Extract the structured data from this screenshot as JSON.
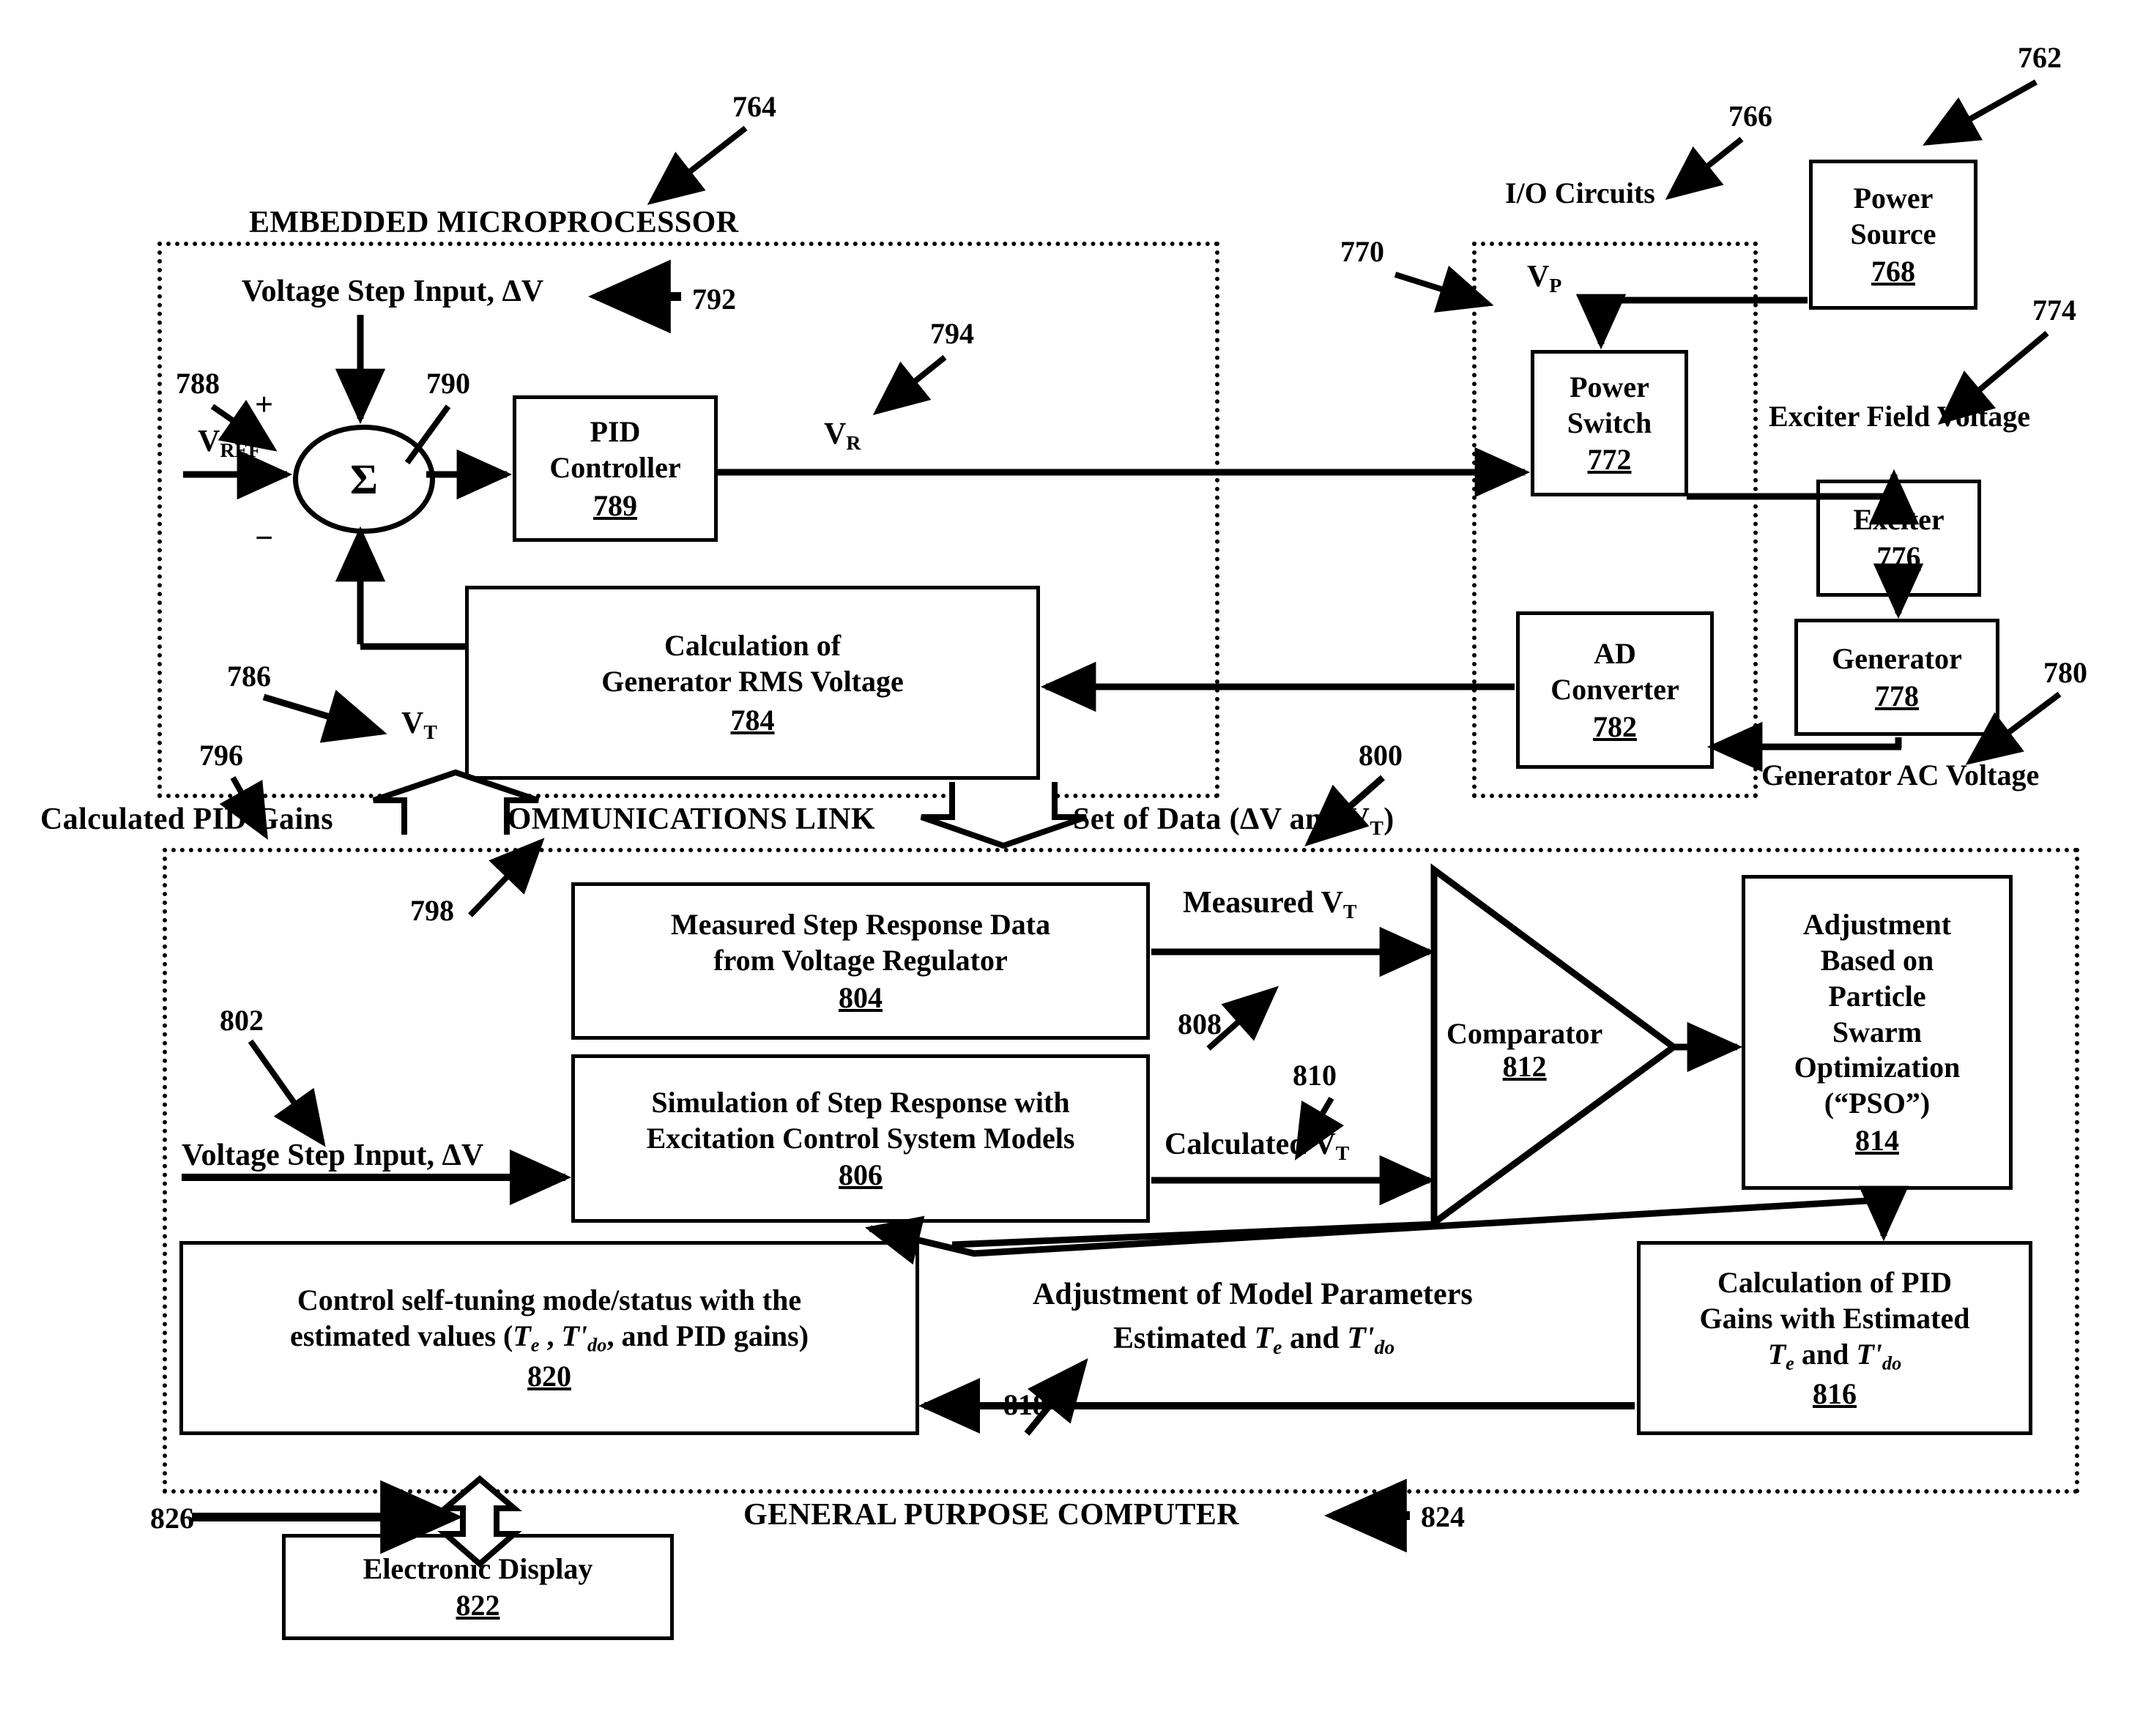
{
  "figure": {
    "enclosures": {
      "embedded_microprocessor": "EMBEDDED MICROPROCESSOR",
      "io_circuits": "I/O Circuits",
      "communications_link": "COMMUNICATIONS LINK",
      "general_purpose_computer": "GENERAL PURPOSE COMPUTER"
    },
    "ref_numbers": {
      "n762": "762",
      "n764": "764",
      "n766": "766",
      "n768": "768",
      "n770": "770",
      "n772": "772",
      "n774": "774",
      "n776": "776",
      "n778": "778",
      "n780": "780",
      "n782": "782",
      "n784": "784",
      "n786": "786",
      "n788": "788",
      "n789": "789",
      "n790": "790",
      "n792": "792",
      "n794": "794",
      "n796": "796",
      "n798": "798",
      "n800": "800",
      "n802": "802",
      "n804": "804",
      "n806": "806",
      "n808": "808",
      "n810": "810",
      "n812": "812",
      "n814": "814",
      "n816": "816",
      "n818": "818",
      "n820": "820",
      "n822": "822",
      "n824": "824",
      "n826": "826"
    },
    "blocks": {
      "pid_controller": {
        "line1": "PID",
        "line2": "Controller",
        "num": "789"
      },
      "rms_calculation": {
        "line1": "Calculation of",
        "line2": "Generator RMS Voltage",
        "num": "784"
      },
      "power_source": {
        "line1": "Power",
        "line2": "Source",
        "num": "768"
      },
      "power_switch": {
        "line1": "Power",
        "line2": "Switch",
        "num": "772"
      },
      "exciter": {
        "line1": "Exciter",
        "num": "776"
      },
      "generator": {
        "line1": "Generator",
        "num": "778"
      },
      "ad_converter": {
        "line1": "AD",
        "line2": "Converter",
        "num": "782"
      },
      "measured_step": {
        "line1": "Measured Step Response Data",
        "line2": "from Voltage Regulator",
        "num": "804"
      },
      "simulation": {
        "line1": "Simulation of Step Response with",
        "line2": "Excitation Control System Models",
        "num": "806"
      },
      "comparator": {
        "line1": "Comparator",
        "num": "812"
      },
      "pso": {
        "lines": [
          "Adjustment",
          "Based on",
          "Particle",
          "Swarm",
          "Optimization",
          "(“PSO”)"
        ],
        "num": "814"
      },
      "pid_gain_calc": {
        "line1": "Calculation of PID",
        "line2": "Gains with Estimated",
        "num": "816"
      },
      "self_tuning": {
        "line1": "Control self-tuning mode/status with the",
        "num": "820"
      },
      "electronic_display": {
        "line1": "Electronic Display",
        "num": "822"
      }
    },
    "signal_labels": {
      "voltage_step_input_top": "Voltage Step Input, ΔV",
      "voltage_step_input_bottom": "Voltage Step Input, ΔV",
      "v_ref": "V",
      "v_ref_sub": "REF",
      "v_t": "V",
      "v_t_sub": "T",
      "v_r": "V",
      "v_r_sub": "R",
      "v_p": "V",
      "v_p_sub": "P",
      "plus": "+",
      "minus": "−",
      "sigma": "Σ",
      "exciter_field_voltage": "Exciter Field Voltage",
      "generator_ac_voltage": "Generator AC Voltage",
      "calculated_pid_gains": "Calculated  PID Gains",
      "set_of_data": "Set of Data (ΔV and V",
      "set_of_data_sub": "T",
      "set_of_data_end": ")",
      "measured_vt": "Measured  V",
      "measured_vt_sub": "T",
      "calculated_vt": "Calculated  V",
      "calculated_vt_sub": "T",
      "adjust_model_params": "Adjustment of Model Parameters",
      "estimated_prefix": "Estimated ",
      "and": " and ",
      "t_e": "T",
      "t_e_sub": "e",
      "t_do": "T'",
      "t_do_sub": "do",
      "self_tuning_line2_a": "estimated values (",
      "self_tuning_line2_b": ", and PID gains)",
      "pid_gains_line3": "and"
    }
  }
}
